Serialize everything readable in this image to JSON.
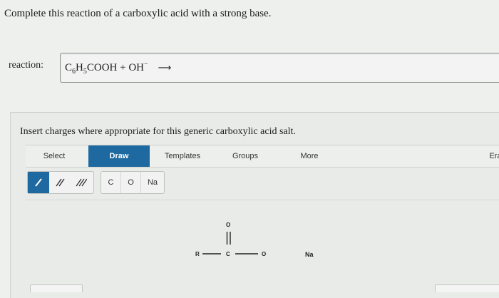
{
  "question": {
    "text": "Complete this reaction of a carboxylic acid with a strong base."
  },
  "reaction": {
    "label": "reaction:",
    "formula_c": "C",
    "formula_sub1": "6",
    "formula_h": "H",
    "formula_sub2": "5",
    "formula_rest": "COOH + OH",
    "formula_sup": "−",
    "arrow": "⟶"
  },
  "editor": {
    "instruction": "Insert charges where appropriate for this generic carboxylic acid salt.",
    "tabs": [
      {
        "label": "Select",
        "active": false
      },
      {
        "label": "Draw",
        "active": true
      },
      {
        "label": "Templates",
        "active": false
      },
      {
        "label": "Groups",
        "active": false
      },
      {
        "label": "More",
        "active": false
      },
      {
        "label": "Era",
        "active": false
      }
    ],
    "atoms": [
      "C",
      "O",
      "Na"
    ],
    "structure": {
      "r": "R",
      "c": "C",
      "o_top": "O",
      "o_right": "O",
      "na": "Na"
    }
  },
  "colors": {
    "accent": "#1e6aa0",
    "background": "#eef0ee"
  }
}
